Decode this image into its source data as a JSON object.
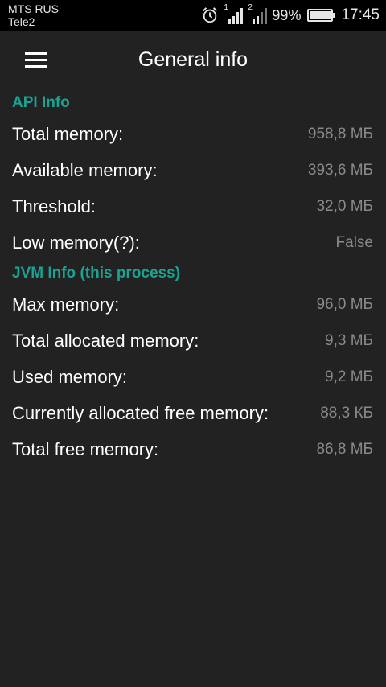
{
  "status_bar": {
    "carrier_1": "MTS RUS",
    "carrier_2": "Tele2",
    "sim_1": "1",
    "sim_2": "2",
    "battery_percent": "99%",
    "battery_level": 0.99,
    "time": "17:45",
    "icons": [
      "alarm-icon",
      "signal-icon",
      "signal-icon",
      "battery-icon"
    ]
  },
  "toolbar": {
    "menu_icon": "menu-icon",
    "title": "General info"
  },
  "api_info": {
    "header": "API Info",
    "rows": [
      {
        "label": "Total memory:",
        "value": "958,8 МБ"
      },
      {
        "label": "Available memory:",
        "value": "393,6 МБ"
      },
      {
        "label": "Threshold:",
        "value": "32,0 МБ"
      },
      {
        "label": "Low memory(?):",
        "value": "False"
      }
    ]
  },
  "jvm_info": {
    "header": "JVM Info (this process)",
    "rows": [
      {
        "label": "Max memory:",
        "value": "96,0 МБ"
      },
      {
        "label": "Total allocated memory:",
        "value": "9,3 МБ"
      },
      {
        "label": "Used memory:",
        "value": "9,2 МБ"
      },
      {
        "label": "Currently allocated free memory:",
        "value": "88,3 КБ"
      },
      {
        "label": "Total free memory:",
        "value": "86,8 МБ"
      }
    ]
  },
  "colors": {
    "accent": "#1aa391",
    "background": "#222222",
    "status_bar": "#000000",
    "value_text": "#8a8a8a"
  }
}
